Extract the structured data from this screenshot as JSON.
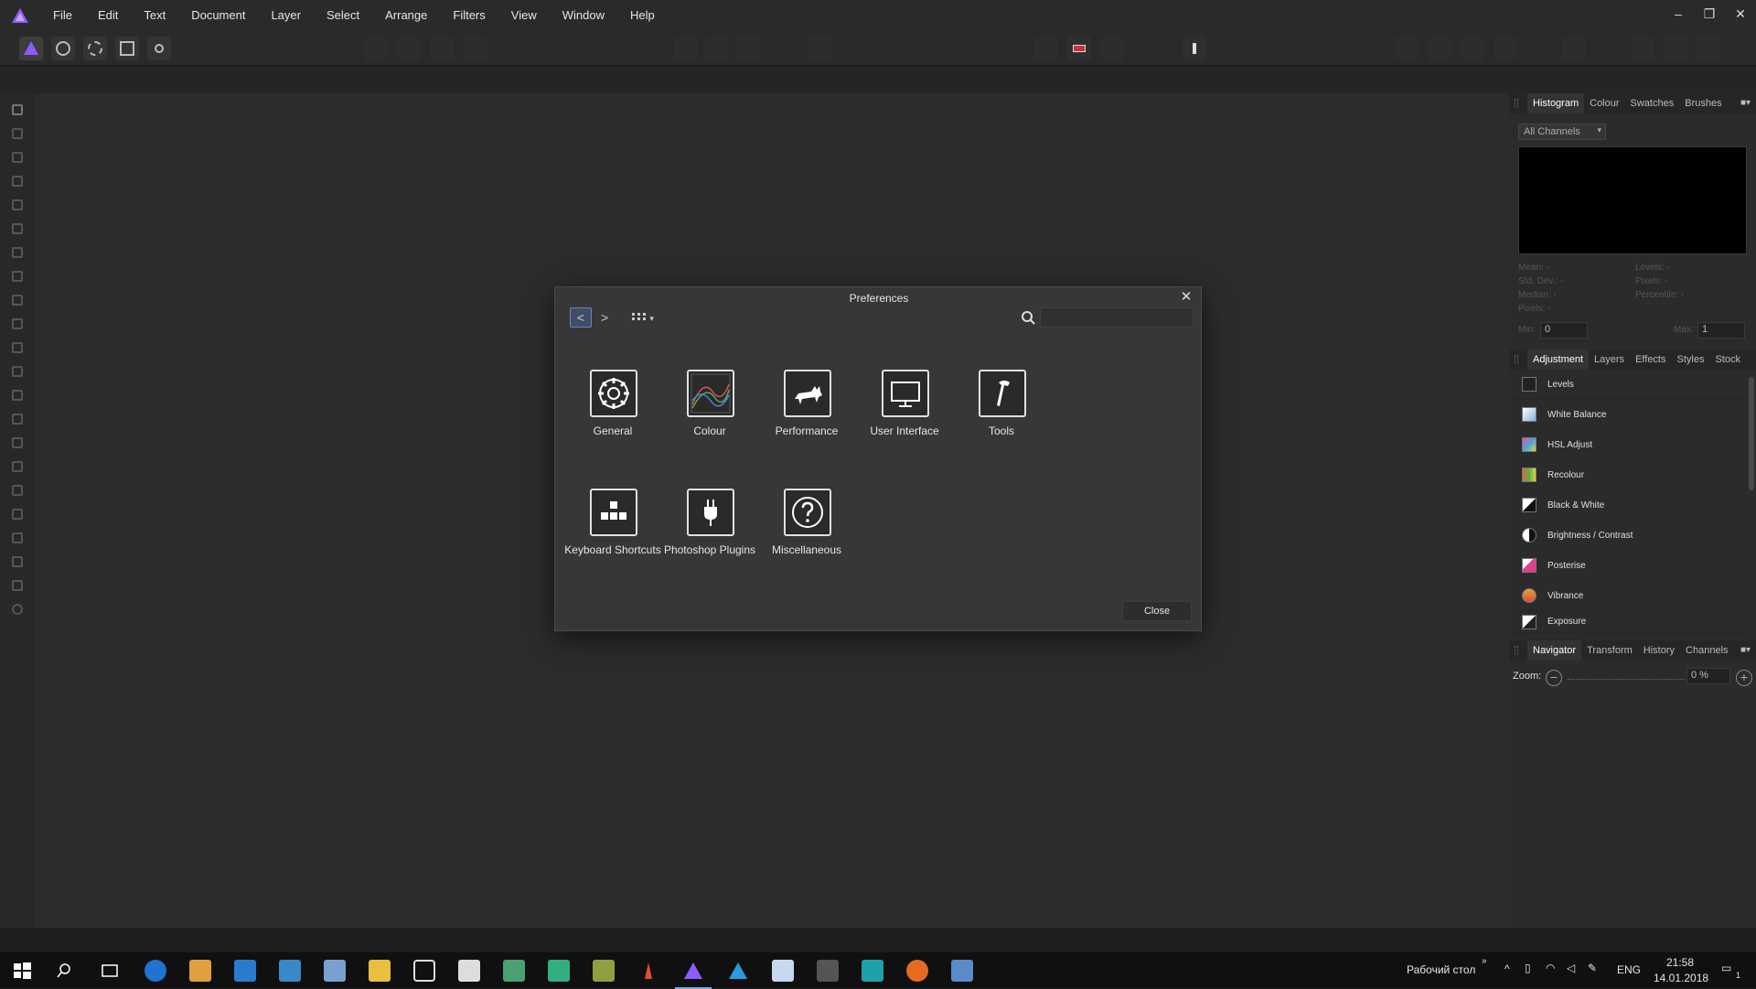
{
  "app": {
    "brand_color": "#8c5cff"
  },
  "menu": {
    "items": [
      "File",
      "Edit",
      "Text",
      "Document",
      "Layer",
      "Select",
      "Arrange",
      "Filters",
      "View",
      "Window",
      "Help"
    ],
    "window_controls": [
      "–",
      "❐",
      "✕"
    ]
  },
  "panels": {
    "histogram": {
      "tabs": [
        "Histogram",
        "Colour",
        "Swatches",
        "Brushes"
      ],
      "channel": "All Channels",
      "stats_left": [
        "Mean: -",
        "Std. Dev.: -",
        "Median: -",
        "Pixels: -"
      ],
      "stats_right": [
        "Levels: -",
        "Pixels: -",
        "Percentile: -"
      ],
      "min_label": "Min:",
      "min_value": "0",
      "max_label": "Max:",
      "max_value": "1"
    },
    "adjustment": {
      "tabs": [
        "Adjustment",
        "Layers",
        "Effects",
        "Styles",
        "Stock"
      ],
      "items": [
        {
          "label": "Levels",
          "color": "#ffffff"
        },
        {
          "label": "White Balance",
          "color": "#7fb3e0"
        },
        {
          "label": "HSL Adjust",
          "color": "#e05a9a"
        },
        {
          "label": "Recolour",
          "color": "#d86a3a"
        },
        {
          "label": "Black & White",
          "color": "#eeeeee"
        },
        {
          "label": "Brightness / Contrast",
          "color": "#cccccc"
        },
        {
          "label": "Posterise",
          "color": "#e0408a"
        },
        {
          "label": "Vibrance",
          "color": "#e3a33a"
        },
        {
          "label": "Exposure",
          "color": "#dddddd"
        }
      ]
    },
    "navigator": {
      "tabs": [
        "Navigator",
        "Transform",
        "History",
        "Channels"
      ],
      "zoom_label": "Zoom:",
      "zoom_value": "0 %"
    }
  },
  "dialog": {
    "title": "Preferences",
    "search_placeholder": "",
    "items": [
      {
        "label": "General",
        "icon": "gear-icon"
      },
      {
        "label": "Colour",
        "icon": "colour-curve-icon"
      },
      {
        "label": "Performance",
        "icon": "cat-icon"
      },
      {
        "label": "User Interface",
        "icon": "monitor-icon"
      },
      {
        "label": "Tools",
        "icon": "hammer-icon"
      },
      {
        "label": "Keyboard Shortcuts",
        "icon": "keyboard-icon"
      },
      {
        "label": "Photoshop Plugins",
        "icon": "plug-icon"
      },
      {
        "label": "Miscellaneous",
        "icon": "question-icon"
      }
    ],
    "close_label": "Close"
  },
  "taskbar": {
    "desktop_label": "Рабочий стол",
    "lang": "ENG",
    "time": "21:58",
    "date": "14.01.2018",
    "notification_count": "1"
  }
}
